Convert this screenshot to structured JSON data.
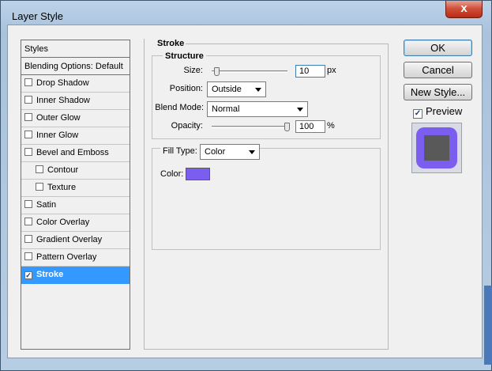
{
  "window": {
    "title": "Layer Style",
    "close_glyph": "x"
  },
  "styles_list": {
    "header": "Styles",
    "blending": "Blending Options: Default",
    "items": [
      {
        "label": "Drop Shadow",
        "checked": false
      },
      {
        "label": "Inner Shadow",
        "checked": false
      },
      {
        "label": "Outer Glow",
        "checked": false
      },
      {
        "label": "Inner Glow",
        "checked": false
      },
      {
        "label": "Bevel and Emboss",
        "checked": false
      },
      {
        "label": "Contour",
        "checked": false
      },
      {
        "label": "Texture",
        "checked": false
      },
      {
        "label": "Satin",
        "checked": false
      },
      {
        "label": "Color Overlay",
        "checked": false
      },
      {
        "label": "Gradient Overlay",
        "checked": false
      },
      {
        "label": "Pattern Overlay",
        "checked": false
      },
      {
        "label": "Stroke",
        "checked": true
      }
    ]
  },
  "stroke": {
    "section_title": "Stroke",
    "structure_title": "Structure",
    "size_label": "Size:",
    "size_value": "10",
    "size_unit": "px",
    "position_label": "Position:",
    "position_value": "Outside",
    "blend_mode_label": "Blend Mode:",
    "blend_mode_value": "Normal",
    "opacity_label": "Opacity:",
    "opacity_value": "100",
    "opacity_unit": "%",
    "fill_type_label": "Fill Type:",
    "fill_type_value": "Color",
    "color_label": "Color:",
    "color_hex": "#7b5ef0"
  },
  "buttons": {
    "ok": "OK",
    "cancel": "Cancel",
    "new_style": "New Style...",
    "preview_label": "Preview",
    "preview_checked": true
  },
  "colors": {
    "selection": "#3399ff",
    "stroke_color": "#7b5ef0",
    "preview_fill": "#595959"
  }
}
